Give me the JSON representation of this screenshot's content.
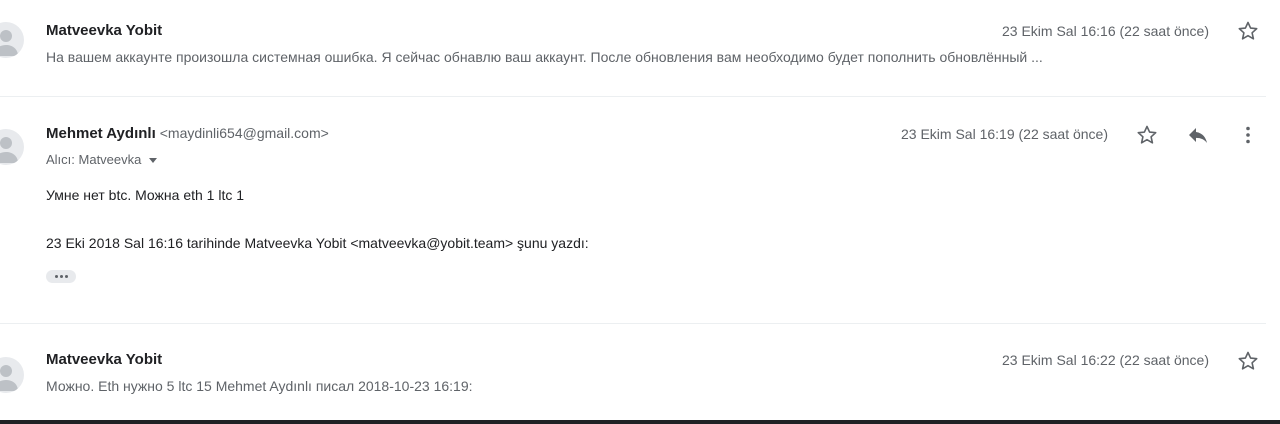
{
  "messages": [
    {
      "sender": "Matveevka Yobit",
      "date": "23 Ekim Sal 16:16 (22 saat önce)",
      "snippet": "На вашем аккаунте произошла системная ошибка. Я сейчас обнавлю ваш аккаунт. После обновления вам необходимо будет пополнить обновлённый ..."
    },
    {
      "sender": "Mehmet Aydınlı",
      "email": "<maydinli654@gmail.com>",
      "date": "23 Ekim Sal 16:19 (22 saat önce)",
      "recipient": "Alıcı: Matveevka",
      "body_line1": "Умне нет btc. Можна eth 1 ltc 1",
      "quote_header": "23 Eki 2018 Sal 16:16 tarihinde Matveevka Yobit <matveevka@yobit.team> şunu yazdı:"
    },
    {
      "sender": "Matveevka Yobit",
      "date": "23 Ekim Sal 16:22 (22 saat önce)",
      "snippet": "Можно. Eth нужно 5 ltc 15 Mehmet Aydınlı писал 2018-10-23 16:19:"
    }
  ],
  "icons": {
    "avatar": "person-avatar-icon",
    "star": "star-outline-icon",
    "reply": "reply-icon",
    "more": "more-vert-icon",
    "expand": "show-trimmed-content-icon"
  },
  "colors": {
    "text_primary": "#202124",
    "text_secondary": "#5f6368",
    "avatar_bg": "#e8eaed"
  }
}
